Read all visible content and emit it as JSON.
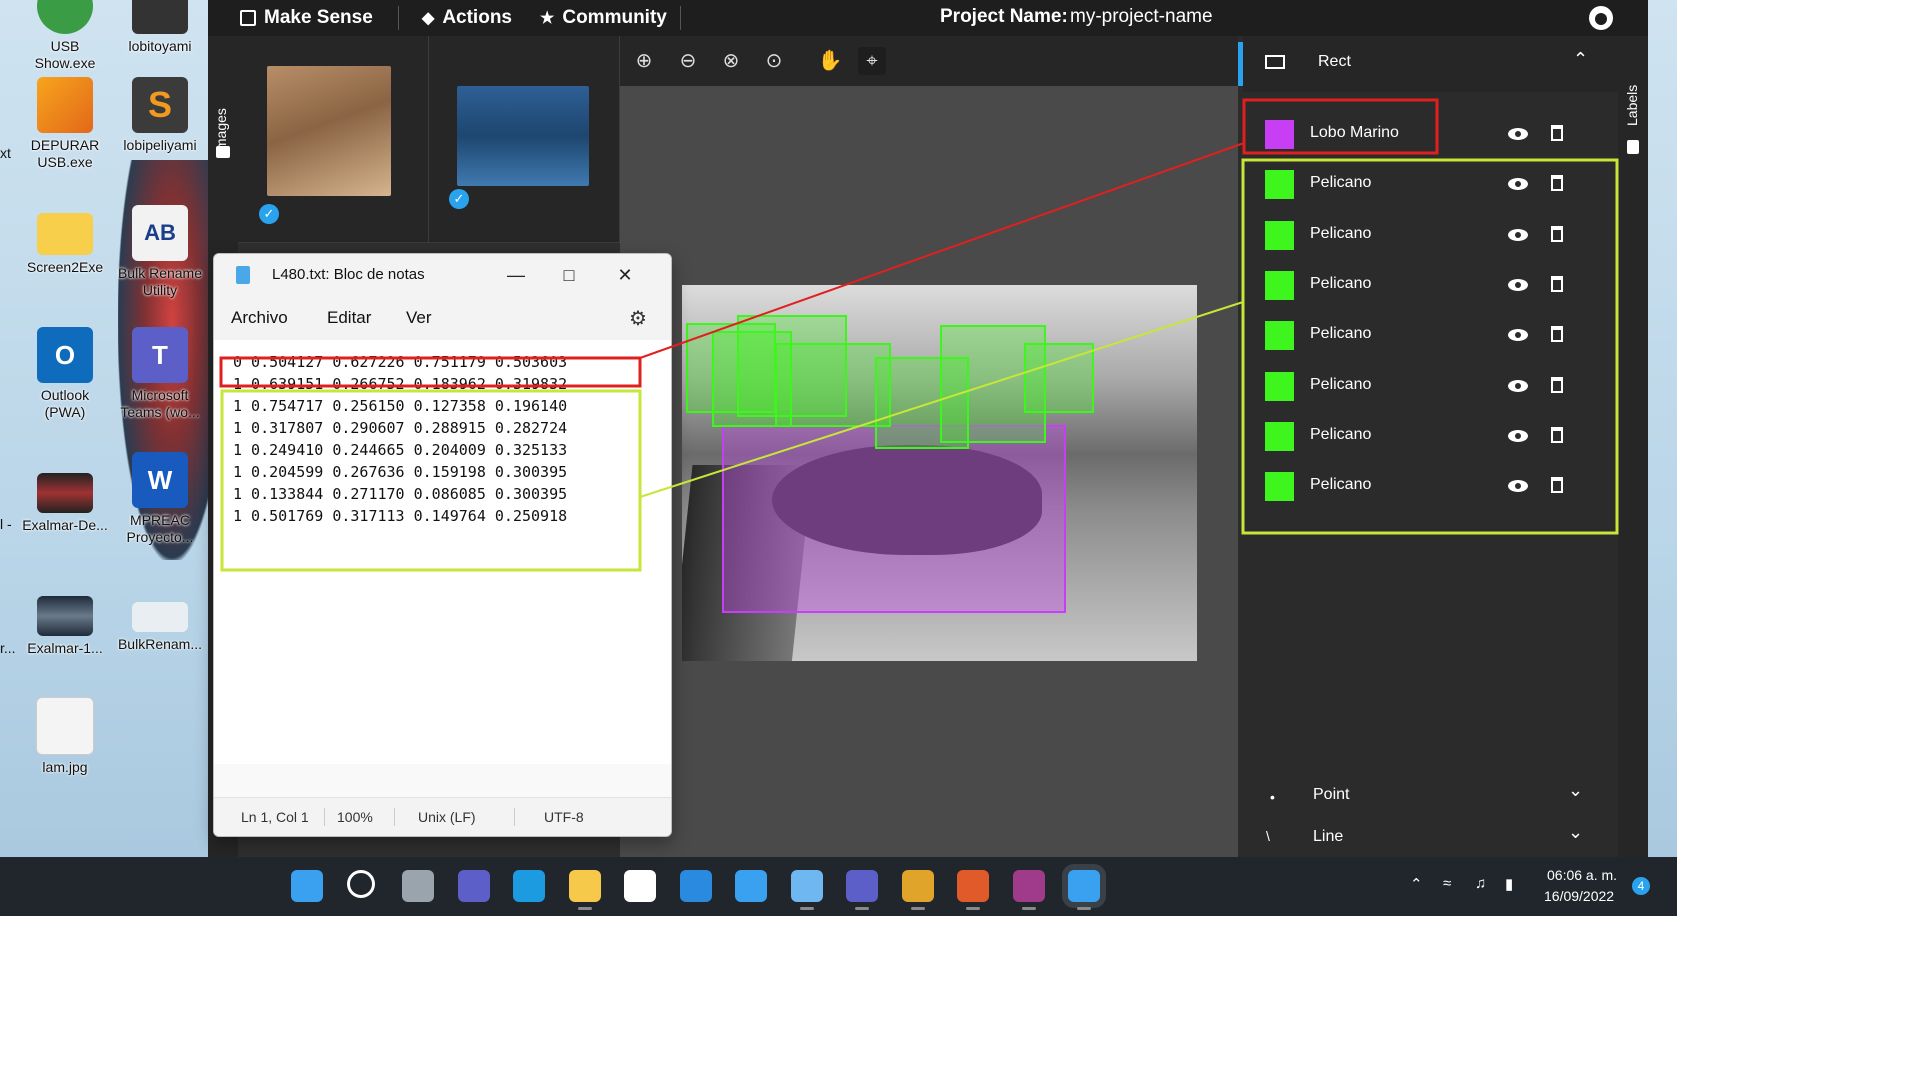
{
  "desktop": {
    "icons": [
      {
        "label": "USB\nShow.exe"
      },
      {
        "label": "lobitoyami"
      },
      {
        "label": "DEPURAR\nUSB.exe"
      },
      {
        "label": "lobipeliyami"
      },
      {
        "label": "Screen2Exe"
      },
      {
        "label": "Bulk Rename\nUtility"
      },
      {
        "label": "Outlook\n(PWA)"
      },
      {
        "label": "Microsoft\nTeams (wo..."
      },
      {
        "label": "Exalmar-De..."
      },
      {
        "label": "MPREAC\nProyecto..."
      },
      {
        "label": "Exalmar-1..."
      },
      {
        "label": "BulkRenam..."
      },
      {
        "label": "lam.jpg"
      }
    ],
    "edge_labels": [
      "xt",
      "l -",
      "r..."
    ]
  },
  "app": {
    "nav": {
      "make_sense": "Make Sense",
      "actions": "Actions",
      "community": "Community"
    },
    "project_label": "Project Name:",
    "project_name": "my-project-name",
    "images_tab": "Images",
    "labels_tab": "Labels",
    "zoom_tools": [
      "zoom-in",
      "zoom-out",
      "zoom-fit",
      "zoom-reset",
      "hand",
      "crosshair"
    ],
    "rect_header": "Rect",
    "labels": [
      {
        "name": "Lobo Marino",
        "color": "#c83ef5"
      },
      {
        "name": "Pelicano",
        "color": "#3ef51d"
      },
      {
        "name": "Pelicano",
        "color": "#3ef51d"
      },
      {
        "name": "Pelicano",
        "color": "#3ef51d"
      },
      {
        "name": "Pelicano",
        "color": "#3ef51d"
      },
      {
        "name": "Pelicano",
        "color": "#3ef51d"
      },
      {
        "name": "Pelicano",
        "color": "#3ef51d"
      },
      {
        "name": "Pelicano",
        "color": "#3ef51d"
      }
    ],
    "point_header": "Point",
    "line_header": "Line"
  },
  "notepad": {
    "title": "L480.txt: Bloc de notas",
    "menu": [
      "Archivo",
      "Editar",
      "Ver"
    ],
    "lines": [
      "0 0.504127 0.627226 0.751179 0.503603",
      "1 0.639151 0.266752 0.183962 0.319832",
      "1 0.754717 0.256150 0.127358 0.196140",
      "1 0.317807 0.290607 0.288915 0.282724",
      "1 0.249410 0.244665 0.204009 0.325133",
      "1 0.204599 0.267636 0.159198 0.300395",
      "1 0.133844 0.271170 0.086085 0.300395",
      "1 0.501769 0.317113 0.149764 0.250918"
    ],
    "status": {
      "position": "Ln 1, Col 1",
      "zoom": "100%",
      "eol": "Unix (LF)",
      "encoding": "UTF-8"
    }
  },
  "taskbar": {
    "apps": [
      "start",
      "search",
      "task-view",
      "chat",
      "edge",
      "file-explorer",
      "store",
      "mail",
      "photos",
      "cortana",
      "teams",
      "chrome",
      "chrome-profile",
      "winrar",
      "notepad"
    ],
    "time": "06:06 a. m.",
    "date": "16/09/2022",
    "notification_count": "4"
  },
  "colors": {
    "red_annotation": "#e0201e",
    "green_annotation": "#c6e63a",
    "purple_box": "#c83ef5",
    "green_box": "#3ef51d",
    "accent": "#2aa3ef"
  }
}
